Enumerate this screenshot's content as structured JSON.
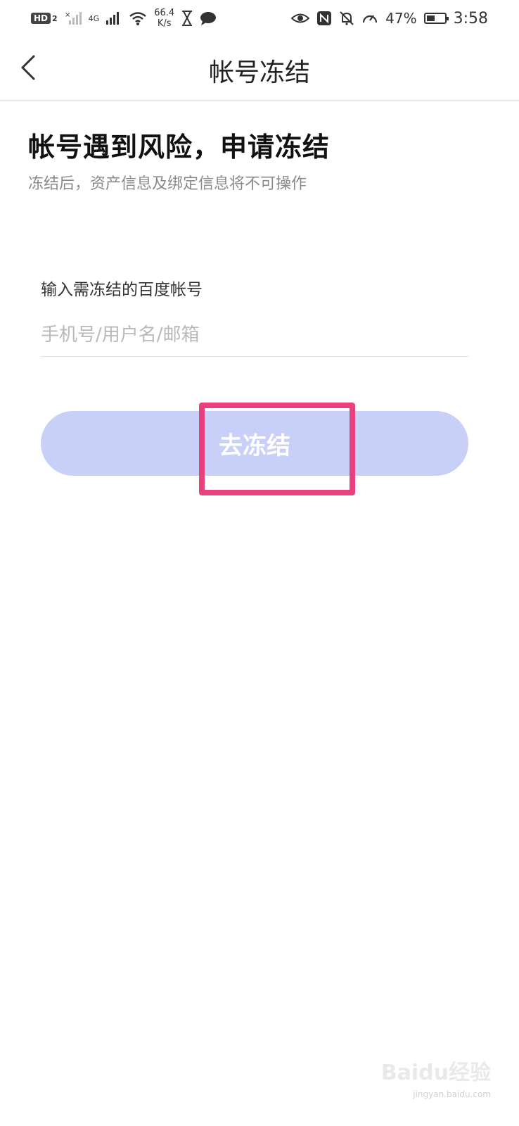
{
  "status_bar": {
    "hd_label": "HD",
    "sim_number": "2",
    "network_label": "4G",
    "net_speed_value": "66.4",
    "net_speed_unit": "K/s",
    "battery_percent": "47%",
    "battery_level": 0.47,
    "time": "3:58",
    "icons": [
      "signal-x-icon",
      "signal-icon",
      "wifi-icon",
      "hourglass-icon",
      "chat-icon",
      "eye-icon",
      "nfc-icon",
      "bell-off-icon",
      "speed-icon",
      "battery-icon"
    ]
  },
  "header": {
    "title": "帐号冻结",
    "back_icon": "chevron-left-icon"
  },
  "main": {
    "headline": "帐号遇到风险，申请冻结",
    "subtitle": "冻结后，资产信息及绑定信息将不可操作",
    "field_label": "输入需冻结的百度帐号",
    "input_placeholder": "手机号/用户名/邮箱",
    "input_value": "",
    "button_label": "去冻结"
  },
  "colors": {
    "button_bg": "#c9d0f7",
    "highlight": "#e8417e"
  },
  "watermark": {
    "text": "Baidu经验",
    "sub": "jingyan.baidu.com"
  }
}
